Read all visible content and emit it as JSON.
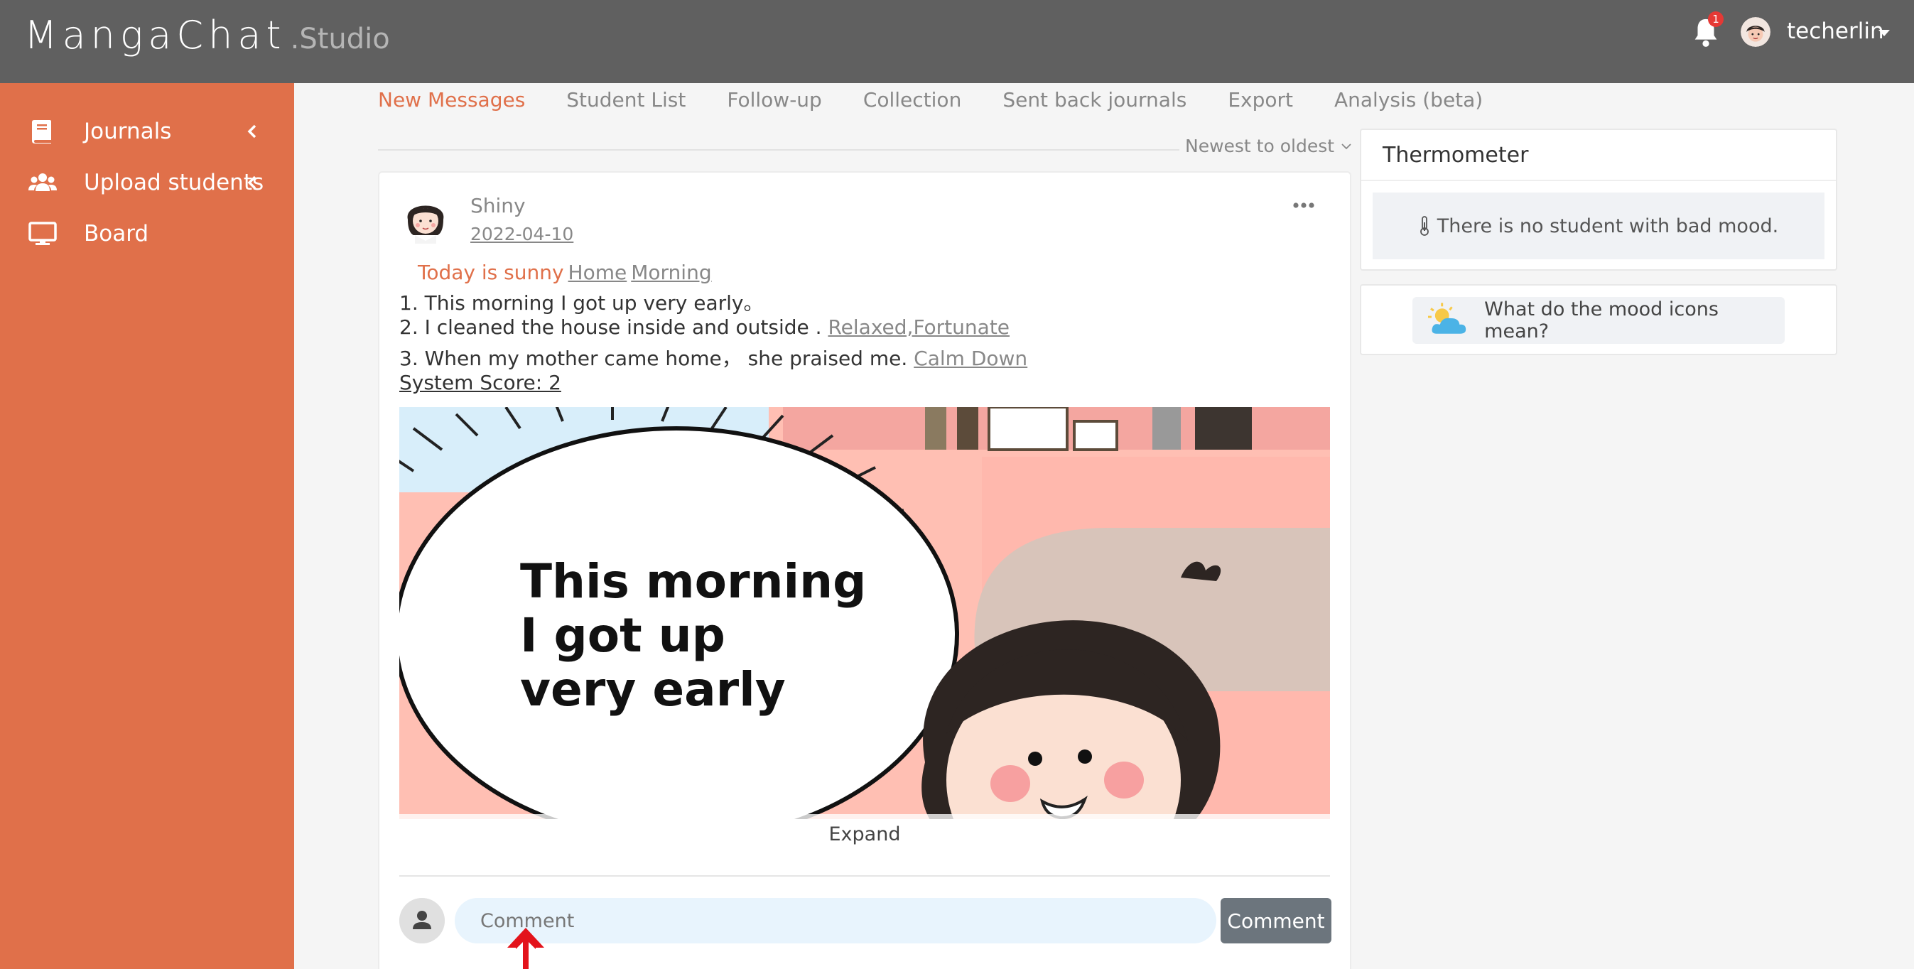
{
  "brand": {
    "name": "MangaChat",
    "suffix": ".Studio"
  },
  "header": {
    "notifications_count": "1",
    "username": "techerlin"
  },
  "sidebar": {
    "items": [
      {
        "label": "Journals",
        "icon": "book-icon"
      },
      {
        "label": "Upload students",
        "icon": "users-icon"
      },
      {
        "label": "Board",
        "icon": "monitor-icon"
      }
    ]
  },
  "tabs": [
    {
      "label": "New Messages",
      "active": true
    },
    {
      "label": "Student List"
    },
    {
      "label": "Follow-up"
    },
    {
      "label": "Collection"
    },
    {
      "label": "Sent back journals"
    },
    {
      "label": "Export"
    },
    {
      "label": "Analysis (beta)"
    }
  ],
  "sort": {
    "label": "Newest to oldest"
  },
  "post": {
    "author": "Shiny",
    "date": "2022-04-10",
    "weather": "Today is sunny",
    "tags": [
      "Home",
      "Morning"
    ],
    "lines": [
      {
        "text": "1. This morning I got up very early。",
        "mood": ""
      },
      {
        "text": "2. I cleaned the house inside and outside .",
        "mood": "Relaxed,Fortunate"
      },
      {
        "text": "3. When my mother came home， she praised me.",
        "mood": "Calm Down"
      }
    ],
    "score": "System Score: 2",
    "manga_text": [
      "This morning",
      "I got up",
      "very early"
    ],
    "expand_label": "Expand"
  },
  "comment": {
    "placeholder": "Comment",
    "button": "Comment"
  },
  "thermometer": {
    "title": "Thermometer",
    "message": "There is no student with bad mood."
  },
  "mood_help": {
    "label": "What do the mood icons mean?"
  },
  "colors": {
    "accent": "#e0704a",
    "topbar": "#606060",
    "comment_bg": "#e8f4fd",
    "button": "#6c757d"
  }
}
